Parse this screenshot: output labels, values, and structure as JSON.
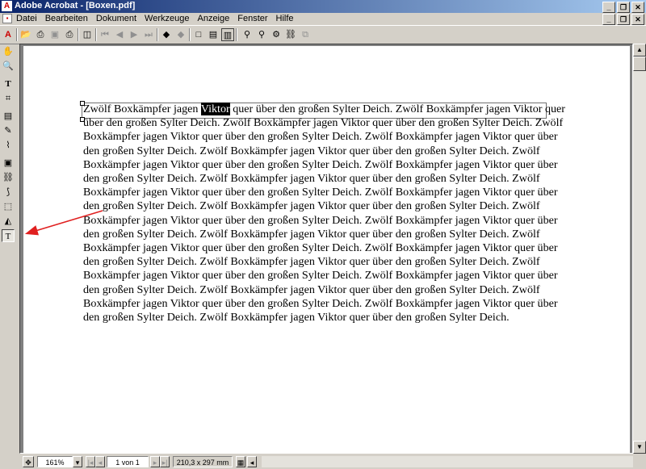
{
  "window": {
    "title": "Adobe Acrobat - [Boxen.pdf]",
    "app_icon": "acrobat-icon",
    "controls": [
      "minimize",
      "restore",
      "close"
    ]
  },
  "menubar": {
    "items": [
      {
        "label": "Datei"
      },
      {
        "label": "Bearbeiten"
      },
      {
        "label": "Dokument"
      },
      {
        "label": "Werkzeuge"
      },
      {
        "label": "Anzeige"
      },
      {
        "label": "Fenster"
      },
      {
        "label": "Hilfe"
      }
    ]
  },
  "toolbar": {
    "icons": [
      "acrobat-icon",
      "open-icon",
      "acquire-icon",
      "save-icon",
      "print-icon",
      "show-hide-navigation-icon",
      "first-page-icon",
      "previous-page-icon",
      "next-page-icon",
      "last-page-icon",
      "go-back-icon",
      "go-forward-icon",
      "actual-size-icon",
      "fit-page-icon",
      "fit-width-icon",
      "find-icon",
      "search-icon",
      "search-results-icon",
      "web-link-icon",
      "view-web-icon"
    ]
  },
  "left_tools": [
    "hand-tool-icon",
    "zoom-tool-icon",
    "text-select-tool-icon",
    "crop-tool-icon",
    "note-tool-icon",
    "pencil-tool-icon",
    "highlight-tool-icon",
    "form-tool-icon",
    "link-tool-icon",
    "article-tool-icon",
    "graphics-select-tool-icon",
    "touchup-object-tool-icon",
    "touchup-text-tool-icon"
  ],
  "document": {
    "first_words": "Zwölf Boxkämpfer jagen ",
    "selected_word": "Viktor",
    "body": " quer über den großen Sylter Deich. Zwölf Boxkämpfer jagen Viktor quer über den großen Sylter Deich. Zwölf Boxkämpfer jagen Viktor quer über den großen Sylter Deich. Zwölf Boxkämpfer jagen Viktor quer über den großen Sylter Deich. Zwölf Boxkämpfer jagen Viktor quer über den großen Sylter Deich. Zwölf Boxkämpfer jagen Viktor quer über den großen Sylter Deich. Zwölf Boxkämpfer jagen Viktor quer über den großen Sylter Deich. Zwölf Boxkämpfer jagen Viktor quer über den großen Sylter Deich. Zwölf Boxkämpfer jagen Viktor quer über den großen Sylter Deich. Zwölf Boxkämpfer jagen Viktor quer über den großen Sylter Deich. Zwölf Boxkämpfer jagen Viktor quer über den großen Sylter Deich. Zwölf Boxkämpfer jagen Viktor quer über den großen Sylter Deich. Zwölf Boxkämpfer jagen Viktor quer über den großen Sylter Deich. Zwölf Boxkämpfer jagen Viktor quer über den großen Sylter Deich. Zwölf Boxkämpfer jagen Viktor quer über den großen Sylter Deich. Zwölf Boxkämpfer jagen Viktor quer über den großen Sylter Deich. Zwölf Boxkämpfer jagen Viktor quer über den großen Sylter Deich. Zwölf Boxkämpfer jagen Viktor quer über den großen Sylter Deich. Zwölf Boxkämpfer jagen Viktor quer über den großen Sylter Deich. Zwölf Boxkämpfer jagen Viktor quer über den großen Sylter Deich. Zwölf Boxkämpfer jagen Viktor quer über den großen Sylter Deich. Zwölf Boxkämpfer jagen Viktor quer über den großen Sylter Deich. Zwölf Boxkämpfer jagen Viktor quer über den großen Sylter Deich. Zwölf Boxkämpfer jagen Viktor quer über den großen Sylter Deich."
  },
  "annotation": {
    "color": "#e02020"
  },
  "statusbar": {
    "zoom": "161%",
    "page": "1 von 1",
    "page_size": "210,3 x 297 mm"
  },
  "colors": {
    "title_start": "#0a246a",
    "title_end": "#a6caf0",
    "chrome": "#d4d0c8",
    "doc_background": "#808080"
  }
}
